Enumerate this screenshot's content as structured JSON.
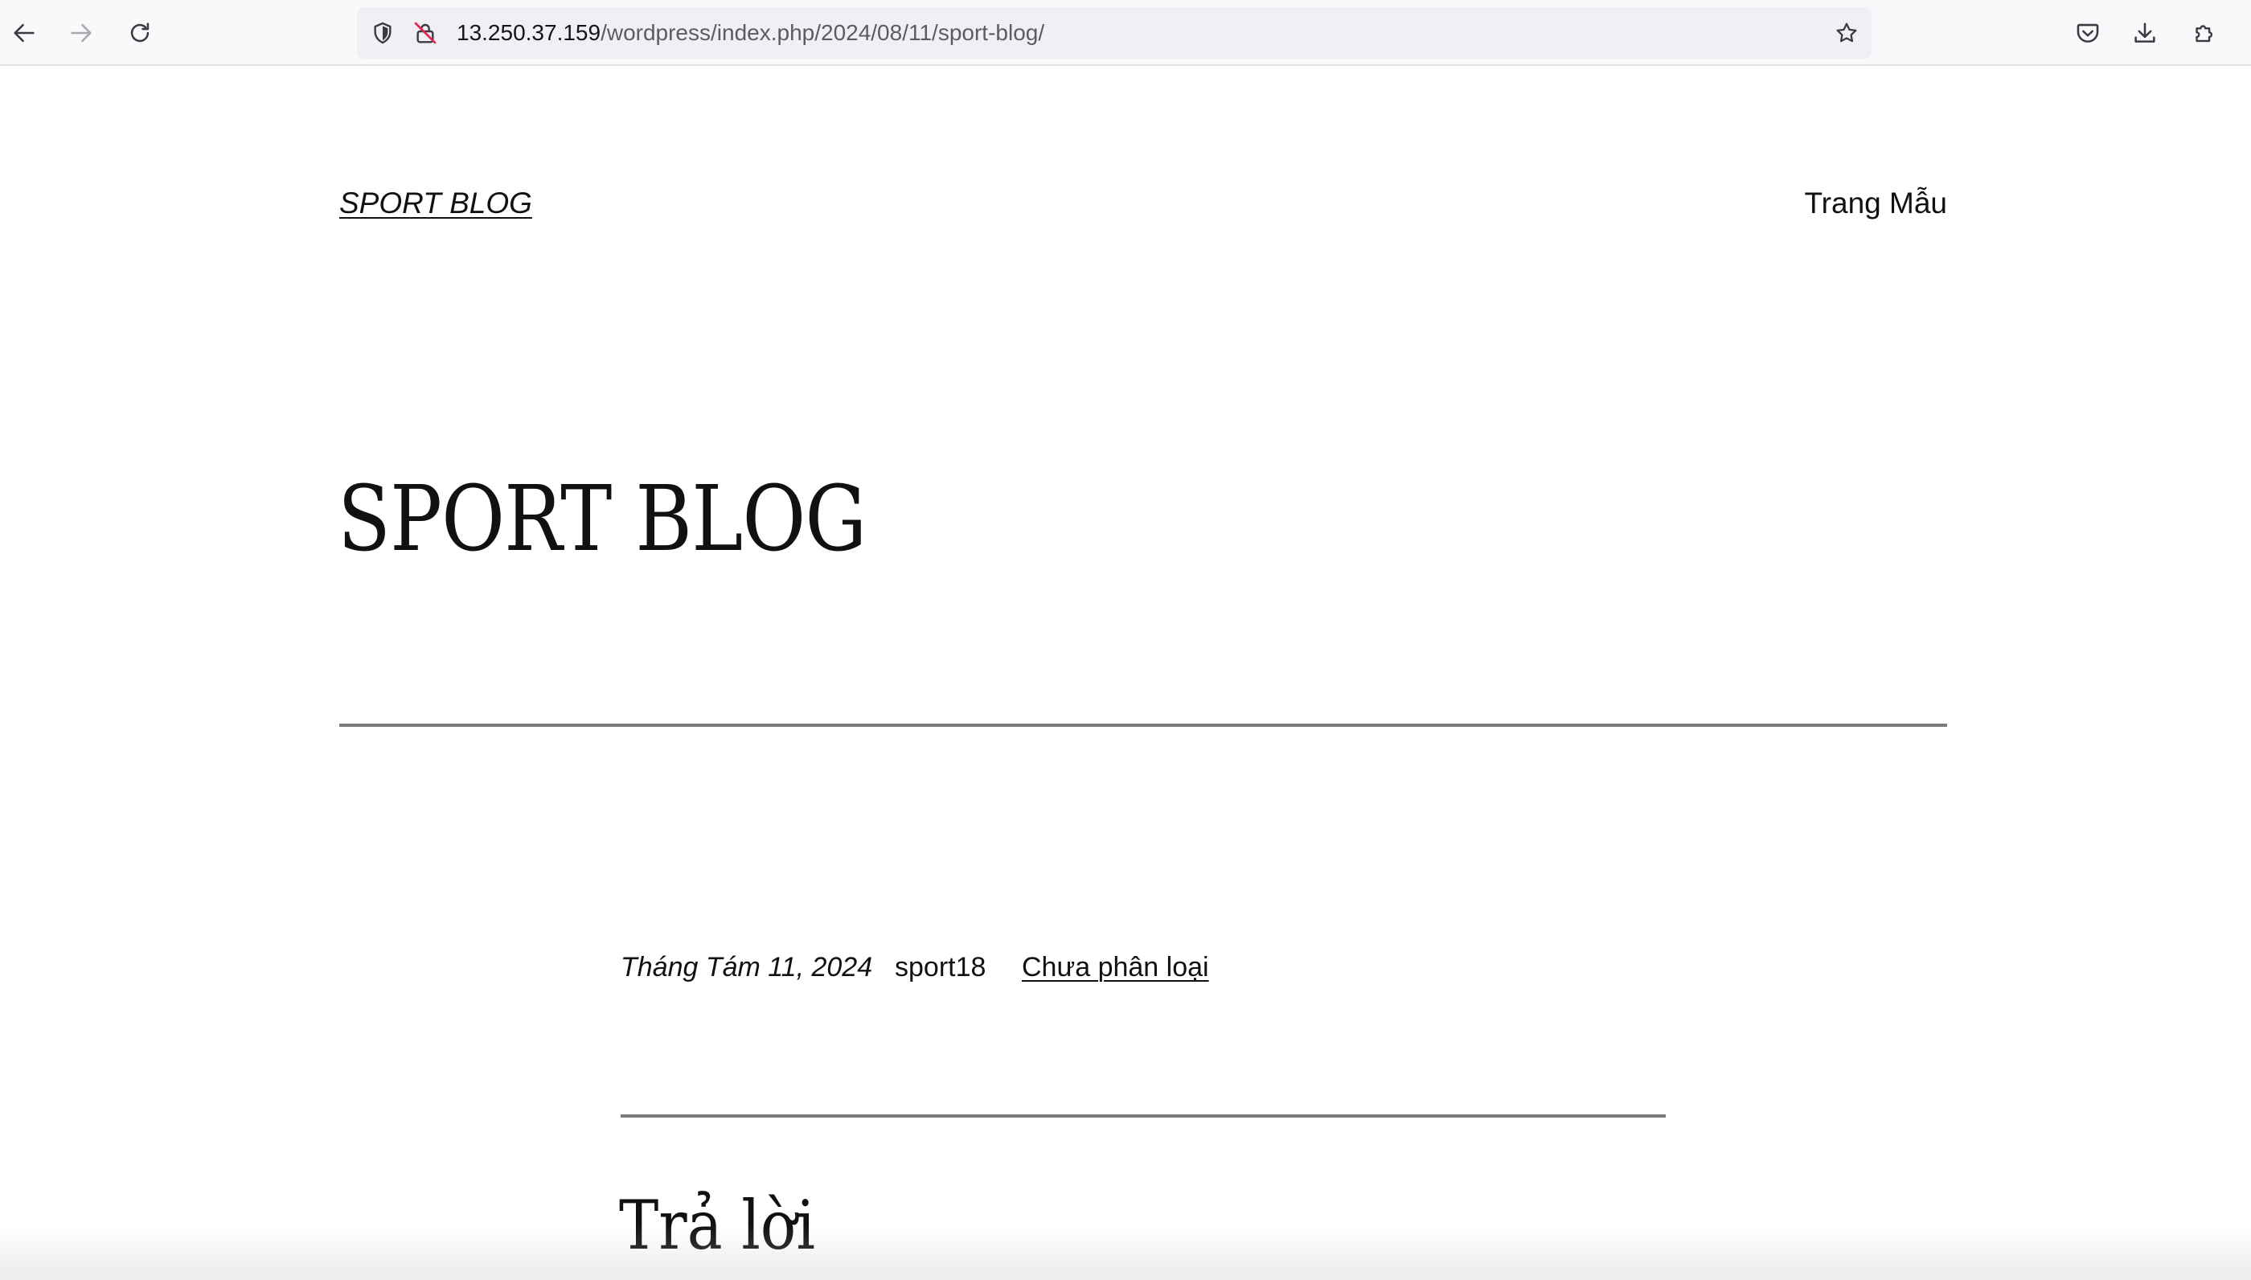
{
  "browser": {
    "url_host": "13.250.37.159",
    "url_path": "/wordpress/index.php/2024/08/11/sport-blog/",
    "icons": {
      "back": "back-arrow-icon",
      "forward": "forward-arrow-icon",
      "reload": "reload-icon",
      "tracking": "shield-icon",
      "insecure": "insecure-lock-icon",
      "bookmark": "star-icon",
      "pocket": "pocket-icon",
      "downloads": "download-icon",
      "extensions": "extensions-icon"
    }
  },
  "header": {
    "site_title": "SPORT BLOG",
    "nav_item": "Trang Mẫu"
  },
  "post": {
    "title": "SPORT BLOG",
    "date": "Tháng Tám 11, 2024",
    "author": "sport18",
    "category": "Chưa phân loại"
  },
  "comments": {
    "heading": "Trả lời"
  },
  "colors": {
    "text": "#111111",
    "rule": "#7a7a7a",
    "toolbar_bg": "#f9f9fb",
    "urlbar_bg": "#f0f0f4",
    "insecure_slash": "#e22850"
  }
}
